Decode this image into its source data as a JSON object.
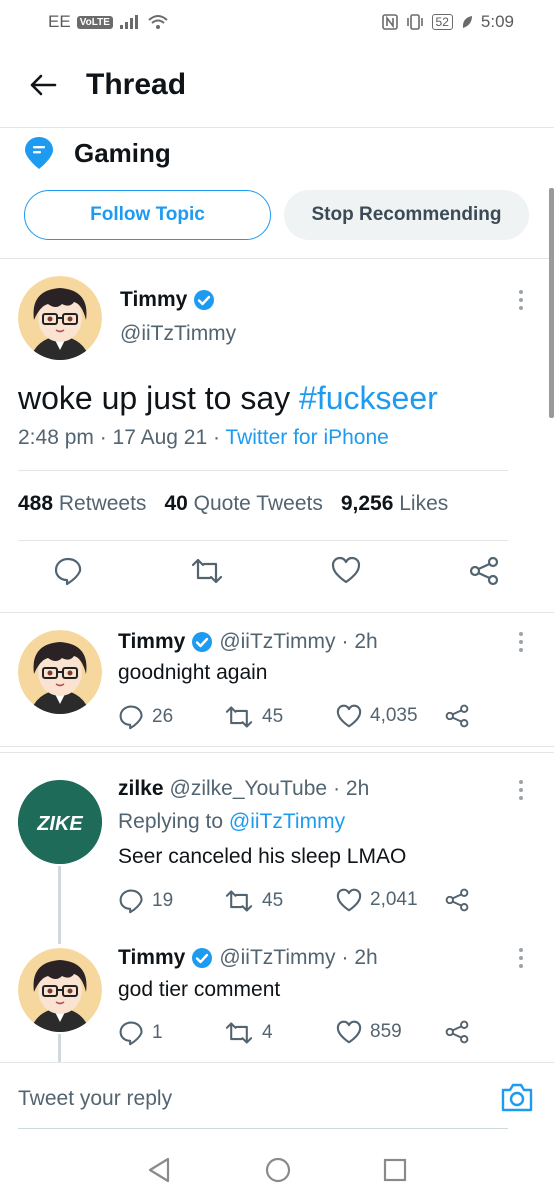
{
  "status_bar": {
    "carrier": "EE",
    "volte": "VoLTE",
    "battery": "52",
    "time": "5:09"
  },
  "header": {
    "title": "Thread"
  },
  "topic": {
    "name": "Gaming",
    "follow_label": "Follow Topic",
    "stop_label": "Stop Recommending"
  },
  "main_tweet": {
    "name": "Timmy",
    "handle": "@iiTzTimmy",
    "text_prefix": "woke up just to say ",
    "hashtag": "#fuckseer",
    "time": "2:48 pm · 17 Aug 21 · ",
    "source": "Twitter for iPhone",
    "retweets_count": "488",
    "retweets_label": "Retweets",
    "quotes_count": "40",
    "quotes_label": "Quote Tweets",
    "likes_count": "9,256",
    "likes_label": "Likes"
  },
  "replies": [
    {
      "name": "Timmy",
      "handle": "@iiTzTimmy",
      "time": "· 2h",
      "text": "goodnight again",
      "replies": "26",
      "retweets": "45",
      "likes": "4,035"
    },
    {
      "name": "zilke",
      "handle": "@zilke_YouTube",
      "time": "· 2h",
      "replying_prefix": "Replying to ",
      "replying_handle": "@iiTzTimmy",
      "text": "Seer canceled his sleep LMAO",
      "replies": "19",
      "retweets": "45",
      "likes": "2,041",
      "avatar_text": "ZIKE"
    },
    {
      "name": "Timmy",
      "handle": "@iiTzTimmy",
      "time": "· 2h",
      "text": "god tier comment",
      "replies": "1",
      "retweets": "4",
      "likes": "859"
    }
  ],
  "compose": {
    "placeholder": "Tweet your reply"
  },
  "colors": {
    "accent": "#1d9bf0",
    "text": "#0f1419",
    "secondary": "#536471",
    "zilke_bg": "#1f6b5a"
  }
}
